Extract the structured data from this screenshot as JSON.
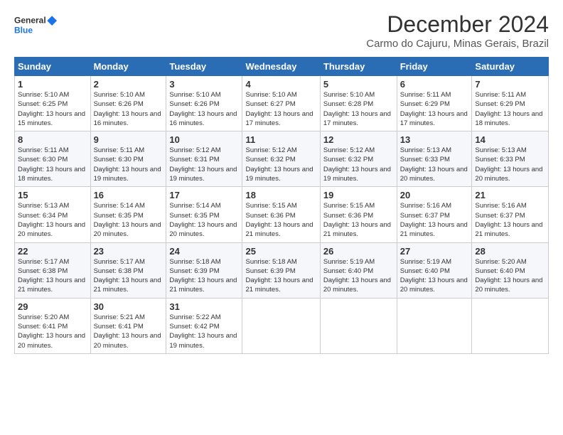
{
  "logo": {
    "line1": "General",
    "line2": "Blue"
  },
  "title": "December 2024",
  "location": "Carmo do Cajuru, Minas Gerais, Brazil",
  "weekdays": [
    "Sunday",
    "Monday",
    "Tuesday",
    "Wednesday",
    "Thursday",
    "Friday",
    "Saturday"
  ],
  "weeks": [
    [
      {
        "day": "1",
        "sunrise": "5:10 AM",
        "sunset": "6:25 PM",
        "daylight": "13 hours and 15 minutes."
      },
      {
        "day": "2",
        "sunrise": "5:10 AM",
        "sunset": "6:26 PM",
        "daylight": "13 hours and 16 minutes."
      },
      {
        "day": "3",
        "sunrise": "5:10 AM",
        "sunset": "6:26 PM",
        "daylight": "13 hours and 16 minutes."
      },
      {
        "day": "4",
        "sunrise": "5:10 AM",
        "sunset": "6:27 PM",
        "daylight": "13 hours and 17 minutes."
      },
      {
        "day": "5",
        "sunrise": "5:10 AM",
        "sunset": "6:28 PM",
        "daylight": "13 hours and 17 minutes."
      },
      {
        "day": "6",
        "sunrise": "5:11 AM",
        "sunset": "6:29 PM",
        "daylight": "13 hours and 17 minutes."
      },
      {
        "day": "7",
        "sunrise": "5:11 AM",
        "sunset": "6:29 PM",
        "daylight": "13 hours and 18 minutes."
      }
    ],
    [
      {
        "day": "8",
        "sunrise": "5:11 AM",
        "sunset": "6:30 PM",
        "daylight": "13 hours and 18 minutes."
      },
      {
        "day": "9",
        "sunrise": "5:11 AM",
        "sunset": "6:30 PM",
        "daylight": "13 hours and 19 minutes."
      },
      {
        "day": "10",
        "sunrise": "5:12 AM",
        "sunset": "6:31 PM",
        "daylight": "13 hours and 19 minutes."
      },
      {
        "day": "11",
        "sunrise": "5:12 AM",
        "sunset": "6:32 PM",
        "daylight": "13 hours and 19 minutes."
      },
      {
        "day": "12",
        "sunrise": "5:12 AM",
        "sunset": "6:32 PM",
        "daylight": "13 hours and 19 minutes."
      },
      {
        "day": "13",
        "sunrise": "5:13 AM",
        "sunset": "6:33 PM",
        "daylight": "13 hours and 20 minutes."
      },
      {
        "day": "14",
        "sunrise": "5:13 AM",
        "sunset": "6:33 PM",
        "daylight": "13 hours and 20 minutes."
      }
    ],
    [
      {
        "day": "15",
        "sunrise": "5:13 AM",
        "sunset": "6:34 PM",
        "daylight": "13 hours and 20 minutes."
      },
      {
        "day": "16",
        "sunrise": "5:14 AM",
        "sunset": "6:35 PM",
        "daylight": "13 hours and 20 minutes."
      },
      {
        "day": "17",
        "sunrise": "5:14 AM",
        "sunset": "6:35 PM",
        "daylight": "13 hours and 20 minutes."
      },
      {
        "day": "18",
        "sunrise": "5:15 AM",
        "sunset": "6:36 PM",
        "daylight": "13 hours and 21 minutes."
      },
      {
        "day": "19",
        "sunrise": "5:15 AM",
        "sunset": "6:36 PM",
        "daylight": "13 hours and 21 minutes."
      },
      {
        "day": "20",
        "sunrise": "5:16 AM",
        "sunset": "6:37 PM",
        "daylight": "13 hours and 21 minutes."
      },
      {
        "day": "21",
        "sunrise": "5:16 AM",
        "sunset": "6:37 PM",
        "daylight": "13 hours and 21 minutes."
      }
    ],
    [
      {
        "day": "22",
        "sunrise": "5:17 AM",
        "sunset": "6:38 PM",
        "daylight": "13 hours and 21 minutes."
      },
      {
        "day": "23",
        "sunrise": "5:17 AM",
        "sunset": "6:38 PM",
        "daylight": "13 hours and 21 minutes."
      },
      {
        "day": "24",
        "sunrise": "5:18 AM",
        "sunset": "6:39 PM",
        "daylight": "13 hours and 21 minutes."
      },
      {
        "day": "25",
        "sunrise": "5:18 AM",
        "sunset": "6:39 PM",
        "daylight": "13 hours and 21 minutes."
      },
      {
        "day": "26",
        "sunrise": "5:19 AM",
        "sunset": "6:40 PM",
        "daylight": "13 hours and 20 minutes."
      },
      {
        "day": "27",
        "sunrise": "5:19 AM",
        "sunset": "6:40 PM",
        "daylight": "13 hours and 20 minutes."
      },
      {
        "day": "28",
        "sunrise": "5:20 AM",
        "sunset": "6:40 PM",
        "daylight": "13 hours and 20 minutes."
      }
    ],
    [
      {
        "day": "29",
        "sunrise": "5:20 AM",
        "sunset": "6:41 PM",
        "daylight": "13 hours and 20 minutes."
      },
      {
        "day": "30",
        "sunrise": "5:21 AM",
        "sunset": "6:41 PM",
        "daylight": "13 hours and 20 minutes."
      },
      {
        "day": "31",
        "sunrise": "5:22 AM",
        "sunset": "6:42 PM",
        "daylight": "13 hours and 19 minutes."
      },
      null,
      null,
      null,
      null
    ]
  ]
}
